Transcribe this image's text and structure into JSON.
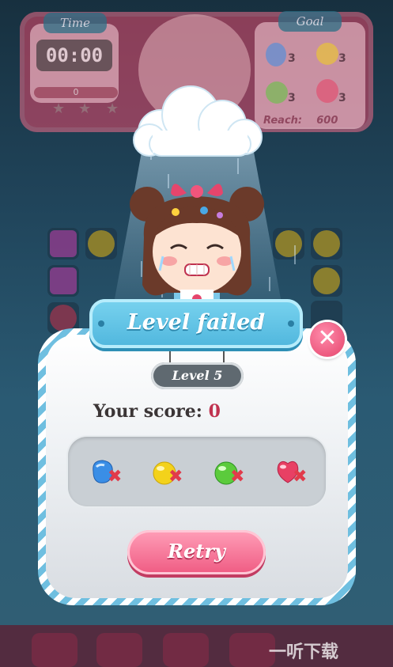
{
  "hud": {
    "time_label": "Time",
    "time_value": "00:00",
    "progress_value": "0",
    "stars_filled": 0,
    "goal_label": "Goal",
    "goals": [
      {
        "candy": "blue-candy",
        "count": "3",
        "color": "#3a8ee6"
      },
      {
        "candy": "yellow-candy",
        "count": "3",
        "color": "#f3d21b"
      },
      {
        "candy": "green-candy",
        "count": "3",
        "color": "#5bcb3c"
      },
      {
        "candy": "red-candy",
        "count": "3",
        "color": "#e84064"
      }
    ],
    "reach_label": "Reach:",
    "reach_value": "600"
  },
  "dialog": {
    "title": "Level failed",
    "level_label": "Level 5",
    "score_label": "Your score:",
    "score_value": "0",
    "close_icon": "close-icon",
    "goal_items": [
      {
        "icon": "blue-candy-icon",
        "color": "#3a8ee6",
        "status_icon": "failed-x-icon"
      },
      {
        "icon": "yellow-candy-icon",
        "color": "#f3d21b",
        "status_icon": "failed-x-icon"
      },
      {
        "icon": "green-candy-icon",
        "color": "#5bcb3c",
        "status_icon": "failed-x-icon"
      },
      {
        "icon": "red-candy-icon",
        "color": "#e84064",
        "status_icon": "failed-x-icon"
      }
    ],
    "retry_label": "Retry"
  },
  "watermark": "一听下载",
  "colors": {
    "accent_pink": "#ef5a82",
    "banner_blue": "#4fb6dd",
    "score_red": "#c0324f"
  }
}
